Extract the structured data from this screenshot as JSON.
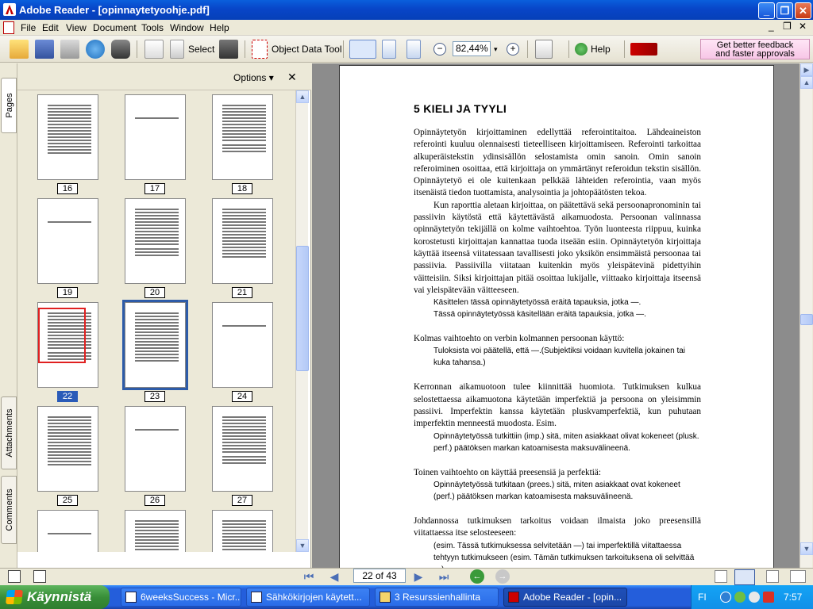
{
  "window": {
    "title": "Adobe Reader - [opinnaytetyoohje.pdf]",
    "min_label": "_",
    "restore_label": "❐",
    "close_label": "✕"
  },
  "menu": {
    "items": [
      "File",
      "Edit",
      "View",
      "Document",
      "Tools",
      "Window",
      "Help"
    ],
    "doc_min_label": "_",
    "doc_restore_label": "❐",
    "doc_close_label": "✕"
  },
  "toolbar": {
    "select_label": "Select",
    "object_data_tool_label": "Object Data Tool",
    "zoom_value": "82,44%",
    "help_label": "Help",
    "promo_line1": "Get better feedback",
    "promo_line2": "and faster approvals"
  },
  "side_tabs": {
    "pages": "Pages",
    "attachments": "Attachments",
    "comments": "Comments"
  },
  "pages_panel": {
    "options_label": "Options",
    "close_label": "✕",
    "page_numbers": [
      "16",
      "17",
      "18",
      "19",
      "20",
      "21",
      "22",
      "23",
      "24",
      "25",
      "26",
      "27"
    ],
    "current_page": "22"
  },
  "document": {
    "heading": "5  KIELI JA TYYLI",
    "p1": "Opinnäytetyön kirjoittaminen edellyttää referointitaitoa. Lähdeaineiston referointi kuuluu olennaisesti tieteelliseen kirjoittamiseen. Referointi tarkoittaa alkuperäistekstin ydinsisällön selostamista omin sanoin. Omin sanoin referoiminen osoittaa, että kirjoittaja on ymmärtänyt referoidun tekstin sisällön. Opinnäytetyö ei ole kuitenkaan pelkkää lähteiden referointia, vaan myös itsenäistä tiedon tuottamista, analysointia ja johtopäätösten tekoa.",
    "p2": "Kun raporttia aletaan kirjoittaa, on päätettävä sekä persoonapronominin tai passiivin käytöstä että käytettävästä aikamuodosta. Persoonan valinnassa opinnäytetyön tekijällä on kolme vaihtoehtoa. Työn luonteesta riippuu, kuinka korostetusti kirjoittajan kannattaa tuoda itseään esiin. Opinnäytetyön kirjoittaja käyttää itseensä viitatessaan tavallisesti joko yksikön ensimmäistä persoonaa tai passiivia. Passiivilla viitataan kuitenkin myös yleispätevinä pidettyihin väitteisiin. Siksi kirjoittajan pitää osoittaa lukijalle, viittaako kirjoittaja itseensä vai yleispätevään väitteeseen.",
    "ex1a": "Käsittelen tässä opinnäytetyössä eräitä tapauksia, jotka —.",
    "ex1b": "Tässä opinnäytetyössä käsitellään eräitä tapauksia, jotka —.",
    "p3": "Kolmas vaihtoehto on verbin kolmannen persoonan käyttö:",
    "ex2": "Tuloksista voi päätellä, että —.(Subjektiksi voidaan kuvitella jokainen tai kuka tahansa.)",
    "p4": "Kerronnan aikamuotoon tulee kiinnittää huomiota. Tutkimuksen kulkua selostettaessa aikamuotona käytetään imperfektiä ja persoona on yleisimmin passiivi. Imperfektin kanssa käytetään pluskvamperfektiä, kun puhutaan imperfektin menneestä muodosta. Esim.",
    "ex3": "Opinnäytetyössä tutkittiin (imp.) sitä, miten asiakkaat olivat kokeneet (plusk. perf.) päätöksen markan katoamisesta maksuvälineenä.",
    "p5": "Toinen vaihtoehto on käyttää preesensiä ja perfektiä:",
    "ex4": "Opinnäytetyössä tutkitaan (prees.) sitä, miten asiakkaat ovat kokeneet (perf.) päätöksen markan katoamisesta maksuvälineenä.",
    "p6": "Johdannossa tutkimuksen tarkoitus voidaan ilmaista joko preesensillä viitattaessa itse selosteeseen:",
    "ex5": "(esim. Tässä tutkimuksessa selvitetään —) tai imperfektillä viitattaessa tehtyyn tutkimukseen (esim. Tämän tutkimuksen tarkoituksena oli selvittää —)."
  },
  "navigation": {
    "page_indicator": "22 of 43"
  },
  "taskbar": {
    "start_label": "Käynnistä",
    "tasks": [
      "6weeksSuccess - Micr...",
      "Sähkökirjojen käytett...",
      "3 Resurssienhallinta",
      "Adobe Reader - [opin..."
    ],
    "language": "FI",
    "clock": "7:57"
  }
}
